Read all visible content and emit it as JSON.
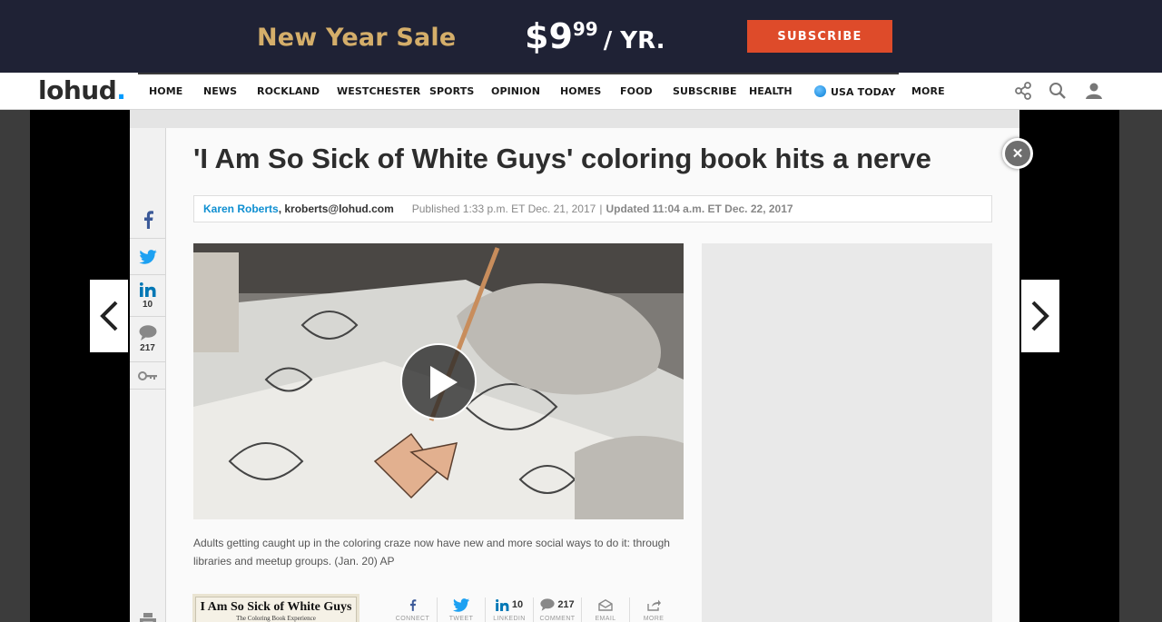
{
  "promo": {
    "sale_text": "New Year Sale",
    "price_dollars": "$9",
    "price_cents": "99",
    "price_period": "/ YR.",
    "button": "SUBSCRIBE"
  },
  "nav": {
    "logo": "lohud",
    "logo_dot": ".",
    "items": [
      "HOME",
      "NEWS",
      "ROCKLAND",
      "WESTCHESTER",
      "SPORTS",
      "OPINION",
      "HOMES",
      "FOOD",
      "SUBSCRIBE",
      "HEALTH",
      "USA TODAY",
      "MORE"
    ]
  },
  "article": {
    "headline": "'I Am So Sick of White Guys' coloring book hits a nerve",
    "author": "Karen Roberts",
    "email": ", kroberts@lohud.com",
    "published": "Published 1:33 p.m. ET Dec. 21, 2017",
    "separator": "|",
    "updated": "Updated 11:04 a.m. ET Dec. 22, 2017",
    "caption": "Adults getting caught up in the coloring craze now have new and more social ways to do it: through libraries and meetup groups. (Jan. 20) AP",
    "book_title": "I Am So Sick of White Guys",
    "book_subtitle": "The Coloring Book Experience"
  },
  "rail": {
    "linkedin_count": "10",
    "comment_count": "217"
  },
  "share": [
    {
      "icon": "facebook-icon",
      "count": "",
      "label": "CONNECT"
    },
    {
      "icon": "twitter-icon",
      "count": "",
      "label": "TWEET"
    },
    {
      "icon": "linkedin-icon",
      "count": "10",
      "label": "LINKEDIN"
    },
    {
      "icon": "comment-icon",
      "count": "217",
      "label": "COMMENT"
    },
    {
      "icon": "email-icon",
      "count": "",
      "label": "EMAIL"
    },
    {
      "icon": "more-icon",
      "count": "",
      "label": "MORE"
    }
  ],
  "colors": {
    "promo_bg": "#1f2235",
    "promo_gold": "#d4ae6a",
    "subscribe_red": "#de4b2a",
    "link_blue": "#0f8fd1",
    "twitter_blue": "#1da1f2",
    "facebook_blue": "#3b5998",
    "linkedin_blue": "#0077b5"
  }
}
